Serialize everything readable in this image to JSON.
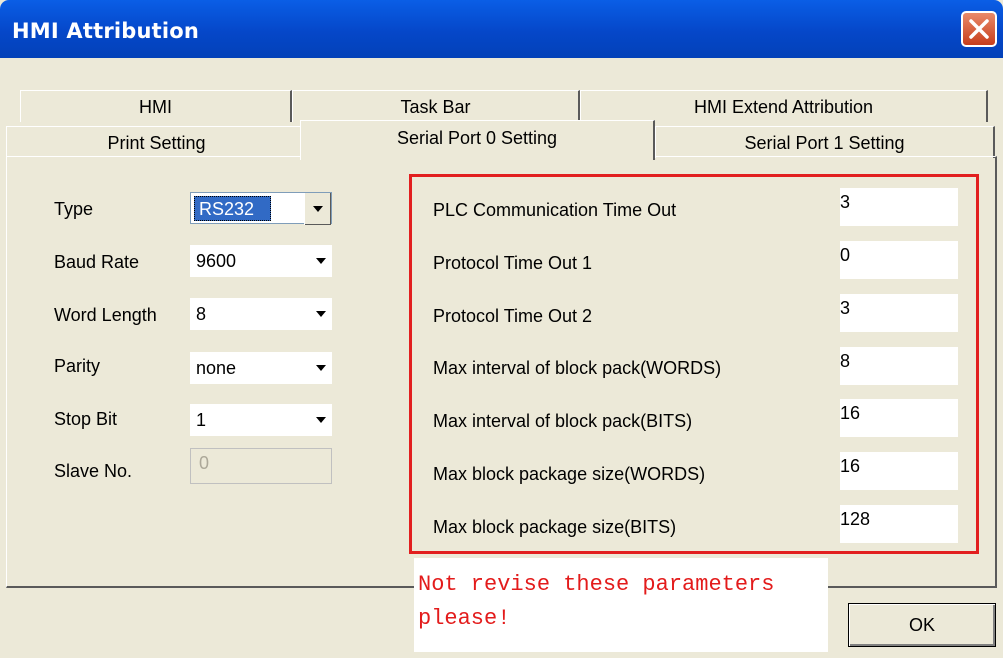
{
  "window": {
    "title": "HMI Attribution"
  },
  "tabs": {
    "row_back": [
      "HMI",
      "Task Bar",
      "HMI Extend Attribution"
    ],
    "row_front": [
      "Print Setting",
      "Serial Port 0 Setting",
      "Serial Port 1 Setting"
    ],
    "active": "Serial Port 0 Setting"
  },
  "serial": {
    "type": {
      "label": "Type",
      "value": "RS232"
    },
    "baud_rate": {
      "label": "Baud Rate",
      "value": "9600"
    },
    "word_length": {
      "label": "Word Length",
      "value": "8"
    },
    "parity": {
      "label": "Parity",
      "value": "none"
    },
    "stop_bit": {
      "label": "Stop Bit",
      "value": "1"
    },
    "slave_no": {
      "label": "Slave No.",
      "value": "0"
    }
  },
  "params": [
    {
      "label": "PLC Communication Time Out",
      "value": "3"
    },
    {
      "label": "Protocol Time Out 1",
      "value": "0"
    },
    {
      "label": "Protocol Time Out 2",
      "value": "3"
    },
    {
      "label": "Max interval of block pack(WORDS)",
      "value": "8"
    },
    {
      "label": "Max interval of block pack(BITS)",
      "value": "16"
    },
    {
      "label": "Max block package size(WORDS)",
      "value": "16"
    },
    {
      "label": "Max block package size(BITS)",
      "value": "128"
    }
  ],
  "annotation": {
    "line1": "Not revise these parameters",
    "line2": "please!"
  },
  "buttons": {
    "ok": "OK"
  },
  "colors": {
    "titlebar": "#0547c9",
    "annotation": "#e21f1f",
    "selection": "#316ac5"
  },
  "icons": {
    "close": "close-icon",
    "dropdown": "chevron-down-icon"
  }
}
